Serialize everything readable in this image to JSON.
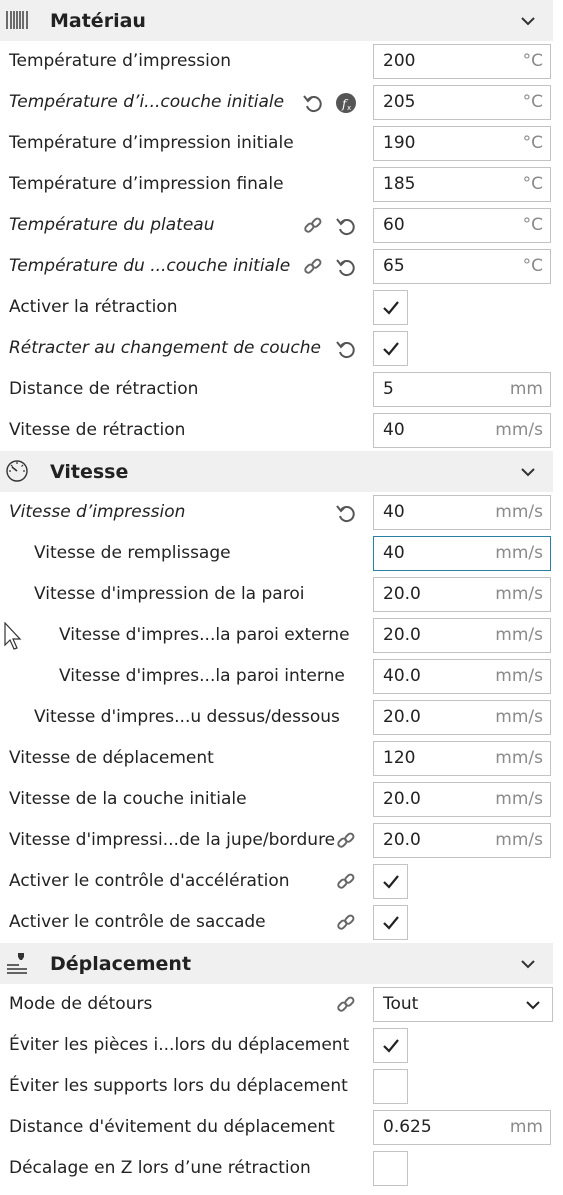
{
  "sections": {
    "materiau": {
      "title": "Matériau",
      "icon": "material-spool-icon"
    },
    "vitesse": {
      "title": "Vitesse",
      "icon": "speedometer-icon"
    },
    "deplacement": {
      "title": "Déplacement",
      "icon": "travel-nozzle-icon"
    }
  },
  "rows": {
    "temp_impression": {
      "label": "Température d’impression",
      "value": "200",
      "unit": "°C"
    },
    "temp_couche_initiale": {
      "label": "Température d’i...couche initiale",
      "value": "205",
      "unit": "°C"
    },
    "temp_impression_initiale": {
      "label": "Température d’impression initiale",
      "value": "190",
      "unit": "°C"
    },
    "temp_impression_finale": {
      "label": "Température d’impression finale",
      "value": "185",
      "unit": "°C"
    },
    "temp_plateau": {
      "label": "Température du plateau",
      "value": "60",
      "unit": "°C"
    },
    "temp_plateau_initiale": {
      "label": "Température du ...couche initiale",
      "value": "65",
      "unit": "°C"
    },
    "activer_retraction": {
      "label": "Activer la rétraction",
      "checked": true
    },
    "retracter_changement": {
      "label": "Rétracter au changement de couche",
      "checked": true
    },
    "distance_retraction": {
      "label": "Distance de rétraction",
      "value": "5",
      "unit": "mm"
    },
    "vitesse_retraction": {
      "label": "Vitesse de rétraction",
      "value": "40",
      "unit": "mm/s"
    },
    "vitesse_impression": {
      "label": "Vitesse d’impression",
      "value": "40",
      "unit": "mm/s"
    },
    "vitesse_remplissage": {
      "label": "Vitesse de remplissage",
      "value": "40",
      "unit": "mm/s"
    },
    "vitesse_paroi": {
      "label": "Vitesse d'impression de la paroi",
      "value": "20.0",
      "unit": "mm/s"
    },
    "vitesse_paroi_externe": {
      "label": "Vitesse d'impres...la paroi externe",
      "value": "20.0",
      "unit": "mm/s"
    },
    "vitesse_paroi_interne": {
      "label": "Vitesse d'impres...la paroi interne",
      "value": "40.0",
      "unit": "mm/s"
    },
    "vitesse_dessus_dessous": {
      "label": "Vitesse d'impres...u dessus/dessous",
      "value": "20.0",
      "unit": "mm/s"
    },
    "vitesse_deplacement": {
      "label": "Vitesse de déplacement",
      "value": "120",
      "unit": "mm/s"
    },
    "vitesse_couche_initiale": {
      "label": "Vitesse de la couche initiale",
      "value": "20.0",
      "unit": "mm/s"
    },
    "vitesse_jupe": {
      "label": "Vitesse d'impressi...de la jupe/bordure",
      "value": "20.0",
      "unit": "mm/s"
    },
    "controle_acceleration": {
      "label": "Activer le contrôle d'accélération",
      "checked": true
    },
    "controle_saccade": {
      "label": "Activer le contrôle de saccade",
      "checked": true
    },
    "mode_detours": {
      "label": "Mode de détours",
      "value": "Tout"
    },
    "eviter_pieces": {
      "label": "Éviter les pièces i...lors du déplacement",
      "checked": true
    },
    "eviter_supports": {
      "label": "Éviter les supports lors du déplacement",
      "checked": false
    },
    "distance_evitement": {
      "label": "Distance d'évitement du déplacement",
      "value": "0.625",
      "unit": "mm"
    },
    "decalage_z": {
      "label": "Décalage en Z lors d’une rétraction",
      "checked": false
    }
  },
  "colors": {
    "header_bg": "#f0f0f0",
    "border": "#c3c3c3",
    "focus": "#2b7fa0",
    "unit": "#8a8a8a"
  }
}
